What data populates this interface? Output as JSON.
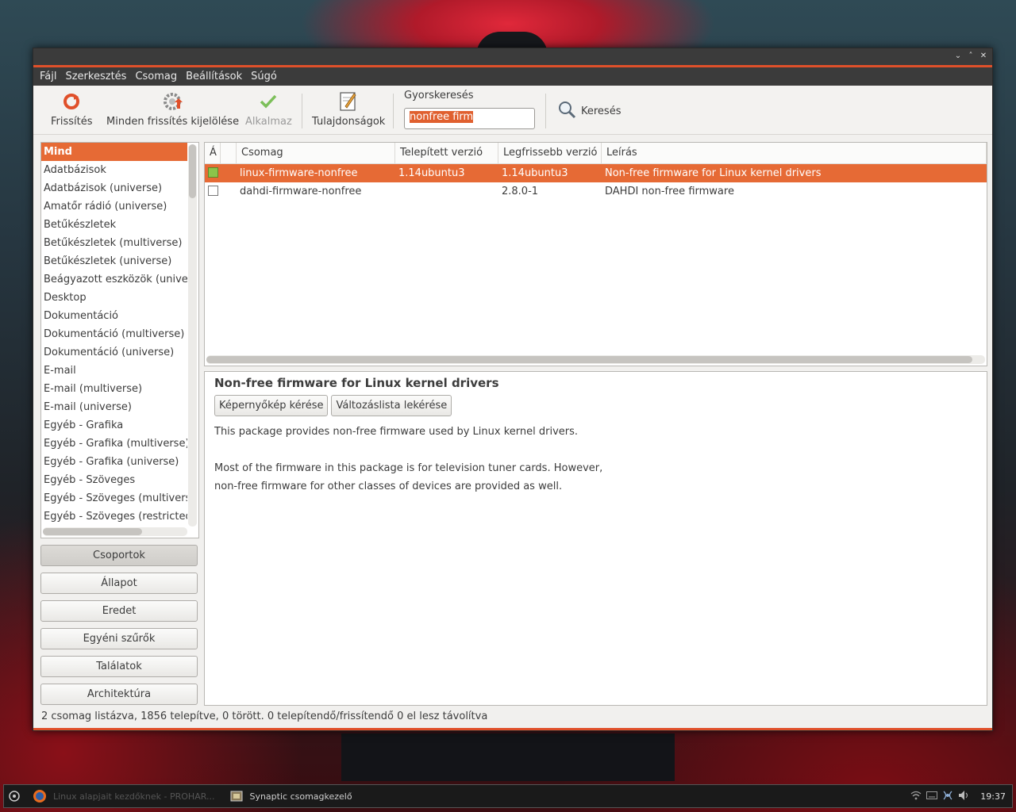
{
  "window": {
    "wm_buttons": [
      "⌄",
      "˄",
      "✕"
    ]
  },
  "menu": [
    "Fájl",
    "Szerkesztés",
    "Csomag",
    "Beállítások",
    "Súgó"
  ],
  "toolbar": {
    "refresh": "Frissítés",
    "mark_all_upgrades": "Minden frissítés kijelölése",
    "apply": "Alkalmaz",
    "properties": "Tulajdonságok",
    "quick_search_label": "Gyorskeresés",
    "quick_search_value": "nonfree firm",
    "search": "Keresés"
  },
  "sections": [
    "Mind",
    "Adatbázisok",
    "Adatbázisok (universe)",
    "Amatőr rádió (universe)",
    "Betűkészletek",
    "Betűkészletek (multiverse)",
    "Betűkészletek (universe)",
    "Beágyazott eszközök (universe)",
    "Desktop",
    "Dokumentáció",
    "Dokumentáció (multiverse)",
    "Dokumentáció (universe)",
    "E-mail",
    "E-mail (multiverse)",
    "E-mail (universe)",
    "Egyéb - Grafika",
    "Egyéb - Grafika (multiverse)",
    "Egyéb - Grafika (universe)",
    "Egyéb - Szöveges",
    "Egyéb - Szöveges (multiverse)",
    "Egyéb - Szöveges (restricted)"
  ],
  "filter_buttons": [
    "Csoportok",
    "Állapot",
    "Eredet",
    "Egyéni szűrők",
    "Találatok",
    "Architektúra"
  ],
  "table": {
    "headers": [
      "Á",
      "",
      "Csomag",
      "Telepített verzió",
      "Legfrissebb verzió",
      "Leírás"
    ],
    "rows": [
      {
        "name": "linux-firmware-nonfree",
        "installed": "1.14ubuntu3",
        "latest": "1.14ubuntu3",
        "desc": "Non-free firmware for Linux kernel drivers",
        "state": "installed"
      },
      {
        "name": "dahdi-firmware-nonfree",
        "installed": "",
        "latest": "2.8.0-1",
        "desc": "DAHDI non-free firmware",
        "state": "not-installed"
      }
    ]
  },
  "details": {
    "title": "Non-free firmware for Linux kernel drivers",
    "screenshot_btn": "Képernyőkép kérése",
    "changelog_btn": "Változáslista lekérése",
    "para1": "This package provides non-free firmware used by Linux kernel drivers.",
    "para2_line1": "Most of the firmware in this package is for television tuner cards. However,",
    "para2_line2": "non-free firmware for other classes of devices are provided as well."
  },
  "status": "2 csomag listázva, 1856 telepítve, 0 törött. 0 telepítendő/frissítendő 0 el lesz távolítva",
  "taskbar": {
    "task1": "Linux alapjait kezdőknek - PROHAR...",
    "task2": "Synaptic csomagkezelő",
    "clock": "19:37"
  },
  "colors": {
    "accent": "#e66a35",
    "titlebar": "#3b3b3b"
  }
}
